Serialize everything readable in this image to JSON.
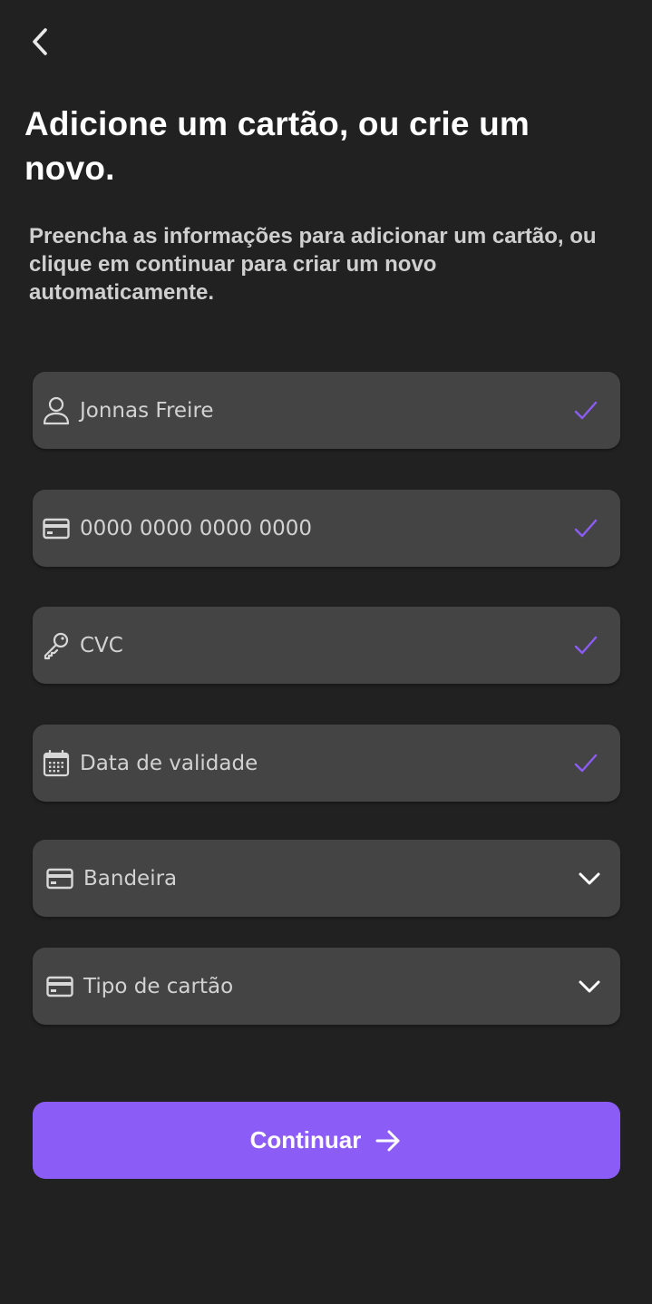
{
  "header": {
    "back_icon": "chevron-left-icon",
    "title": "Adicione um cartão, ou crie um novo.",
    "subtitle": "Preencha as informações para adicionar um cartão, ou clique em continuar para criar um novo automaticamente."
  },
  "form": {
    "fields": [
      {
        "icon": "user-icon",
        "value": "Jonnas Freire",
        "status": "valid"
      },
      {
        "icon": "credit-card-icon",
        "value": "0000 0000 0000 0000",
        "status": "valid"
      },
      {
        "icon": "key-icon",
        "value": "CVC",
        "status": "valid"
      },
      {
        "icon": "calendar-icon",
        "value": "Data de validade",
        "status": "valid"
      },
      {
        "icon": "credit-card-icon",
        "value": "Bandeira",
        "type": "select"
      },
      {
        "icon": "credit-card-icon",
        "value": "Tipo de cartão",
        "type": "select"
      }
    ]
  },
  "cta": {
    "label": "Continuar",
    "icon": "arrow-right-icon"
  },
  "colors": {
    "background": "#212121",
    "field_background": "#444444",
    "accent": "#8c5cf6",
    "check": "#8c5cf6",
    "field_text": "#d2d2d2"
  }
}
